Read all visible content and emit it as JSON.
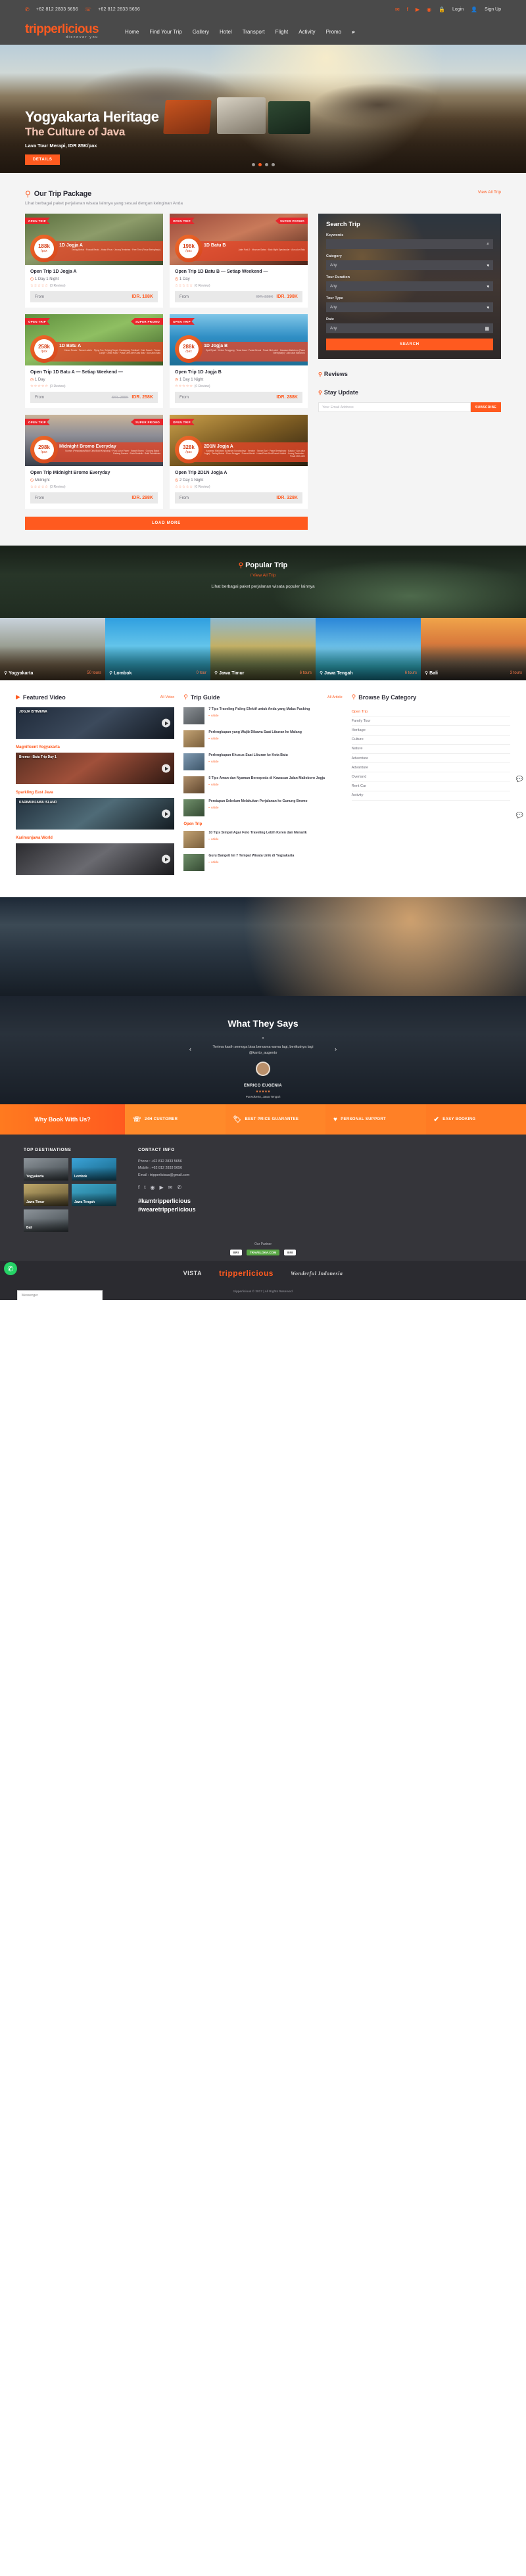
{
  "topbar": {
    "whatsapp_icon": "whatsapp-icon",
    "phone1": "+62 812 2833 5656",
    "phone_icon": "phone-icon",
    "phone2": "+62 812 2833 5656",
    "socials": [
      "envelope-icon",
      "facebook-icon",
      "youtube-icon",
      "instagram-icon"
    ],
    "login": "Login",
    "signup": "Sign Up"
  },
  "brand": {
    "name": "tripperlicious",
    "tagline": "discover you"
  },
  "nav": {
    "items": [
      "Home",
      "Find Your Trip",
      "Gallery",
      "Hotel",
      "Transport",
      "Flight",
      "Activity",
      "Promo"
    ],
    "search_icon": "search-icon"
  },
  "hero": {
    "title": "Yogyakarta Heritage",
    "subtitle": "The Culture of Java",
    "caption": "Lava Tour Merapi, IDR 85K/pax",
    "cta": "DETAILS",
    "dots": 4,
    "active_dot": 2
  },
  "packages": {
    "title": "Our Trip Package",
    "pin_icon": "map-pin-icon",
    "view_all": "View All Trip",
    "subtitle": "Lihat berbagai paket perjalanan wisata lainnya yang sesuai dengan keinginan Anda",
    "load_more": "LOAD MORE",
    "labels": {
      "from": "From",
      "review": "(0 Review)",
      "open_trip": "OPEN TRIP",
      "super_promo": "SUPER PROMO"
    },
    "cards": [
      {
        "name": "Open Trip 1D Jogja A",
        "duration": "1 Day 1 Night",
        "price": "IDR. 188K",
        "old_price": "",
        "badge": "188k",
        "per": "/pax",
        "start_from": "Start From",
        "banner_title": "1D Jogja A",
        "banner_detail": "Tebing Breksi · Puncak Becici - Hutan Pinus · Jurang Tembelan · Free Time (Pasar Beringharjo)",
        "promo": false,
        "theme": "forest"
      },
      {
        "name": "Open Trip 1D Batu B — Setiap Weekend —",
        "duration": "1 Day",
        "price": "IDR. 198K",
        "old_price": "IDR. 228K",
        "badge": "198k",
        "per": "/pax",
        "start_from": "Start From",
        "banner_title": "1D Batu B",
        "banner_detail": "Jatim Park 2 · Museum Satwa · Batu Night Spectacular · Alun-alun Batu",
        "promo": true,
        "theme": "city"
      },
      {
        "name": "Open Trip 1D Batu A — Setiap Weekend —",
        "duration": "1 Day",
        "price": "IDR. 258K",
        "old_price": "IDR. 288K",
        "badge": "258k",
        "per": "/pax",
        "start_from": "Start From",
        "banner_title": "1D Batu A",
        "banner_detail": "Coban Rondo - Taman Labirin · Flying Fox, Sniping Target, Paralayang, Paintball · Cafe Sawah · Taman Langit · Omah Kayu · Pusat Oleh-oleh Khas Batu · Alun-alun Batu",
        "promo": true,
        "theme": "maze"
      },
      {
        "name": "Open Trip 1D Jogja B",
        "duration": "1 Day 1 Night",
        "price": "IDR. 288K",
        "old_price": "",
        "badge": "288k",
        "per": "/pax",
        "start_from": "Start From",
        "banner_title": "1D Jogja B",
        "banner_detail": "Spot Riyadi · Kebun Penggang · Teras Kaca · Pantai Seruni · Pusat Oleh-oleh · Kawasan Malioboro (Pasar Beringharjo) · Alun-alun Malioboro",
        "promo": false,
        "theme": "beach"
      },
      {
        "name": "Open Trip Midnight Bromo Everyday",
        "duration": "Midnight",
        "price": "IDR. 298K",
        "old_price": "",
        "badge": "298k",
        "per": "/pax",
        "start_from": "Start From",
        "banner_title": "Midnight Bromo Everyday",
        "banner_detail": "Sunrise (Penanjakan/Bukit Cinta/Bukit Kingkong) · Pura Luhur Poten · Kawah Bromo · Gunung Batok · Padang Savana · Pasir Berbisik · Bukit Teletubbies",
        "promo": true,
        "theme": "bromo"
      },
      {
        "name": "Open Trip 2D1N Jogja A",
        "duration": "2 Day 1 Night",
        "price": "IDR. 328K",
        "old_price": "",
        "badge": "328k",
        "per": "/pax",
        "start_from": "Start From",
        "banner_title": "2D1N Jogja A",
        "banner_detail": "Kawasan Malioboro (Museum Sonobudoyo · Keraton · Taman Sari · Pasar Beringharjo · Bakpia · Alun-alun Jogja) · Tebing Breksi · Pinus Pengger · Puncak Becici · HutanPinus Seri/Rumah Hobbit · Jurang Tembelan · Pusat Oleh-oleh",
        "promo": false,
        "theme": "treehouse"
      }
    ]
  },
  "search_widget": {
    "title": "Search Trip",
    "keywords_label": "Keywords",
    "keywords_placeholder": "",
    "search_icon": "search-icon",
    "category_label": "Category",
    "category_value": "Any",
    "duration_label": "Tour Duration",
    "duration_value": "Any",
    "tour_type_label": "Tour Type",
    "tour_type_value": "Any",
    "date_label": "Date",
    "date_value": "Any",
    "calendar_icon": "calendar-icon",
    "button": "SEARCH"
  },
  "reviews": {
    "title": "Reviews",
    "pin_icon": "map-pin-icon"
  },
  "stay_update": {
    "title": "Stay Update",
    "pin_icon": "map-pin-icon",
    "email_placeholder": "Your Email Address",
    "button": "SUBSCRIBE"
  },
  "popular": {
    "title": "Popular Trip",
    "pin_icon": "map-pin-icon",
    "view_all": "/  View All Trip",
    "subtitle": "Lihat berbagai paket perjalanan wisata  populer lainnya",
    "destinations": [
      {
        "name": "Yogyakarta",
        "tours": "50 tours"
      },
      {
        "name": "Lombok",
        "tours": "0 tour"
      },
      {
        "name": "Jawa Timur",
        "tours": "6 tours"
      },
      {
        "name": "Jawa Tengah",
        "tours": "6 tours"
      },
      {
        "name": "Bali",
        "tours": "3 tours"
      }
    ]
  },
  "featured_video": {
    "title": "Featured Video",
    "pin_icon": "play-icon",
    "view_all": "All Video",
    "groups": [
      {
        "label": "",
        "caption": "JOGJA ISTIMEWA"
      },
      {
        "label": "Magnificent Yogyakarta",
        "caption": "Bromo - Batu Trip Day 1"
      },
      {
        "label": "Sparkling East Java",
        "caption": "KARIMUNJAWA ISLAND"
      },
      {
        "label": "Karimunjawa World",
        "caption": ""
      }
    ]
  },
  "trip_guide": {
    "title": "Trip Guide",
    "pin_icon": "map-pin-icon",
    "view_all": "All Article",
    "items": [
      {
        "text": "7 Tips Traveling Paling Efektif untuk Anda yang Malas Packing",
        "meta": "Article"
      },
      {
        "text": "Perlengkapan yang Wajib Dibawa Saat Liburan ke Malang",
        "meta": "Article"
      },
      {
        "text": "Perlengkapan Khusus Saat Liburan ke Kota Batu",
        "meta": "Article"
      },
      {
        "text": "5 Tips Aman dan Nyaman Bersepeda di Kawasan Jalan Malioboro Jogja",
        "meta": "Article"
      },
      {
        "text": "Persiapan Sebelum Melakukan Perjalanan ke Gunung Bromo",
        "meta": "Article"
      },
      {
        "text": "10 Tips Simpel Agar Foto Traveling Lebih Keren dan Menarik",
        "meta": "Article"
      },
      {
        "text": "Guru Bangeti Ini 7 Tempat Wisata Unik di Yogyakarta",
        "meta": "Article"
      }
    ],
    "group_label": "Open Trip"
  },
  "browse_category": {
    "title": "Browse By Category",
    "pin_icon": "map-pin-icon",
    "items": [
      "Open Trip",
      "Family Tour",
      "Heritage",
      "Culture",
      "Nature",
      "Adventure",
      "Advanture",
      "Overland",
      "Rent Car",
      "Activity"
    ]
  },
  "testimonial": {
    "title": "What They Says",
    "quote_mark": "“",
    "text": "Terima kasih semoga bisa bersama-sama lagi, berikutnya lagi",
    "handle": "@kanto_augento",
    "author": "ENRICO EUGENIA",
    "stars": "★★★★★",
    "location": "Purwokerto, Jawa Tengah",
    "prev_icon": "chevron-left-icon",
    "next_icon": "chevron-right-icon"
  },
  "why_book": {
    "lead": "Why Book With Us?",
    "items": [
      {
        "icon": "headset-icon",
        "label": "24H CUSTOMER"
      },
      {
        "icon": "tag-icon",
        "label": "BEST PRICE GUARANTEE"
      },
      {
        "icon": "heart-icon",
        "label": "PERSONAL SUPPORT"
      },
      {
        "icon": "check-icon",
        "label": "EASY BOOKING"
      }
    ]
  },
  "footer": {
    "destinations_title": "TOP DESTINATIONS",
    "destinations": [
      "Yogyakarta",
      "Lombok",
      "Jawa Timur",
      "Jawa Tengah",
      "Bali"
    ],
    "contact_title": "CONTACT INFO",
    "contact": [
      "Phone : +62 812 2833 5656",
      "Mobile : +62 812 2833 5656",
      "Email : tripperlicious@gmail.com"
    ],
    "socials": [
      "facebook-icon",
      "twitter-icon",
      "instagram-icon",
      "youtube-icon",
      "envelope-icon",
      "whatsapp-icon"
    ],
    "tags": [
      "#kamtripperlicious",
      "#wearetripperlicious"
    ],
    "partner_label": "Our Partner",
    "partners": [
      "BRI",
      "TRAVELOKA.COM",
      "BNI"
    ],
    "bottom_logos": [
      "VISTA",
      "tripperlicious",
      "Wonderful Indonesia"
    ],
    "copyright": "tripperlicious © 2017 | All Rights Reserved"
  },
  "widgets": {
    "whatsapp_icon": "whatsapp-icon",
    "chat_placeholder": "Messenger",
    "chat_icon": "chat-icon"
  }
}
